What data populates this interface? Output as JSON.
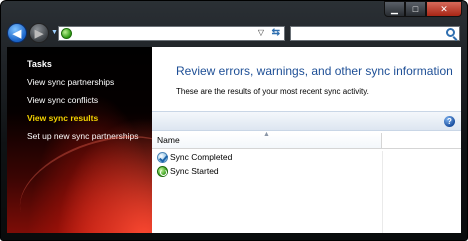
{
  "window": {
    "caption_buttons": {
      "minimize_glyph": "▁",
      "maximize_glyph": "□",
      "close_glyph": "✕"
    }
  },
  "toolbar": {
    "back_icon": "back-arrow-icon",
    "forward_icon": "forward-arrow-icon",
    "back_glyph": "◀",
    "forward_glyph": "▶",
    "nav_dropdown_glyph": "▼",
    "address": {
      "icon": "sync-center-icon",
      "value": "",
      "dropdown_glyph": "▽",
      "refresh_glyph": "⇆"
    },
    "search": {
      "value": "",
      "placeholder": ""
    }
  },
  "sidebar": {
    "heading": "Tasks",
    "items": [
      {
        "label": "View sync partnerships",
        "active": false
      },
      {
        "label": "View sync conflicts",
        "active": false
      },
      {
        "label": "View sync results",
        "active": true
      },
      {
        "label": "Set up new sync partnerships",
        "active": false
      }
    ]
  },
  "main": {
    "title": "Review errors, warnings, and other sync information",
    "description": "These are the results of your most recent sync activity.",
    "help_glyph": "?",
    "columns": [
      {
        "label": "Name",
        "sort_glyph": "▲"
      }
    ],
    "rows": [
      {
        "name": "Sync Completed",
        "icon": "sync-completed-icon"
      },
      {
        "name": "Sync Started",
        "icon": "sync-started-icon"
      }
    ]
  },
  "colors": {
    "title_blue": "#1e4f96",
    "active_task_yellow": "#f4d400",
    "sidebar_red": "#b8140a"
  }
}
